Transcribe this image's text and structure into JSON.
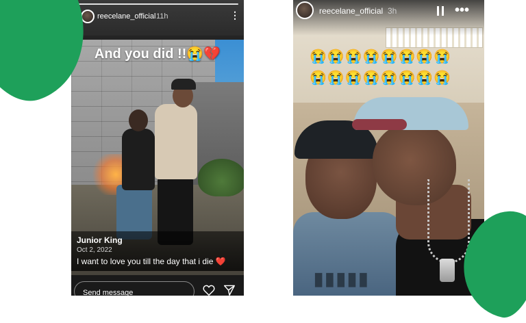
{
  "left_story": {
    "username": "reecelane_official",
    "time_ago": "11h",
    "menu_icon": "kebab-vertical-icon",
    "overlay_caption": {
      "text": "And you did !!",
      "emojis": "😭💔"
    },
    "shared_post": {
      "author": "Junior King",
      "date": "Oct 2, 2022",
      "text": "I want to love you till the day that i die",
      "emoji": "❤️"
    },
    "reply": {
      "placeholder": "Send message",
      "like_icon": "heart-outline-icon",
      "send_icon": "paper-plane-icon"
    }
  },
  "right_story": {
    "username": "reecelane_official",
    "time_ago": "3h",
    "pause_icon": "pause-icon",
    "more_icon": "more-horizontal-icon",
    "emoji_row_1": "😭😭😭😭😭😭😭😭",
    "emoji_row_2": "😭😭😭😭😭😭😭😭"
  },
  "colors": {
    "brand_green": "#1ea05a",
    "heart_red": "#e0242f"
  }
}
